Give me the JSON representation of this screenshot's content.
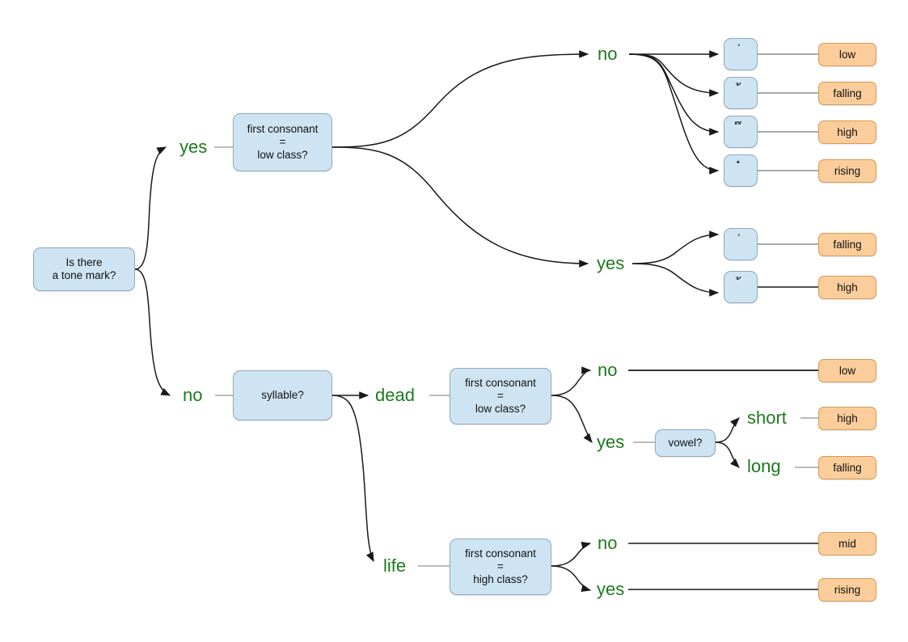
{
  "diagram": {
    "title": "Thai tone determination decision tree",
    "colors": {
      "question_fill": "#cfe4f2",
      "question_border": "#8fa9bb",
      "result_fill": "#fbcd9b",
      "result_border": "#d99a55",
      "label_text": "#1e7a1e",
      "edge": "#1a1a1a",
      "background": "#ffffff"
    },
    "root": {
      "text": "Is there\na tone mark?"
    },
    "questions": {
      "tone_low_class": "first consonant\n=\nlow class?",
      "syllable": "syllable?",
      "dead_low_class": "first consonant\n=\nlow class?",
      "vowel": "vowel?",
      "life_high_class": "first consonant\n=\nhigh class?"
    },
    "labels": {
      "root_yes": "yes",
      "root_no": "no",
      "tone_lowclass_no": "no",
      "tone_lowclass_yes": "yes",
      "syllable_dead": "dead",
      "syllable_life": "life",
      "dead_no": "no",
      "dead_yes": "yes",
      "vowel_short": "short",
      "vowel_long": "long",
      "life_no": "no",
      "life_yes": "yes"
    },
    "tone_marks": {
      "mai_ek": "่",
      "mai_tho": "้",
      "mai_tri": "๊",
      "mai_chattawa": "๋"
    },
    "results": {
      "not_low_ek": "low",
      "not_low_tho": "falling",
      "not_low_tri": "high",
      "not_low_chattawa": "rising",
      "low_ek": "falling",
      "low_tho": "high",
      "dead_not_low": "low",
      "dead_low_short": "high",
      "dead_low_long": "falling",
      "life_not_high": "mid",
      "life_high": "rising"
    }
  }
}
